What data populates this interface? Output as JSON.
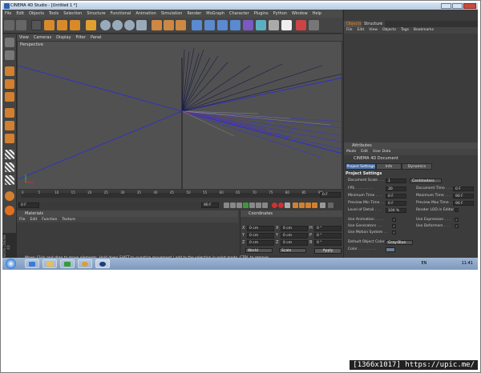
{
  "window": {
    "title": "CINEMA 4D Studio - [Untitled 1 *]"
  },
  "menubar": [
    "File",
    "Edit",
    "Objects",
    "Tools",
    "Selection",
    "Structure",
    "Functional",
    "Animation",
    "Simulation",
    "Render",
    "MoGraph",
    "Character",
    "Plugins",
    "Python",
    "Window",
    "Help"
  ],
  "viewport": {
    "menu": [
      "View",
      "Cameras",
      "Display",
      "Filter",
      "Panel"
    ],
    "label": "Perspective"
  },
  "timeline": {
    "ticks": [
      "0",
      "5",
      "10",
      "15",
      "20",
      "25",
      "30",
      "35",
      "40",
      "45",
      "50",
      "55",
      "60",
      "65",
      "70",
      "75",
      "80",
      "85",
      "90"
    ],
    "end_field": "0 F",
    "start_field": "0 F",
    "current_field": "90 F"
  },
  "materials": {
    "title": "Materials",
    "menu": [
      "File",
      "Edit",
      "Function",
      "Texture"
    ]
  },
  "coordinates": {
    "title": "Coordinates",
    "rows": [
      {
        "a": "X",
        "a_val": "0 cm",
        "b": "X",
        "b_val": "0 cm",
        "c": "H",
        "c_val": "0 °"
      },
      {
        "a": "Y",
        "a_val": "0 cm",
        "b": "Y",
        "b_val": "0 cm",
        "c": "P",
        "c_val": "0 °"
      },
      {
        "a": "Z",
        "a_val": "0 cm",
        "b": "Z",
        "b_val": "0 cm",
        "c": "B",
        "c_val": "0 °"
      }
    ],
    "mode_world": "World",
    "mode_scale": "Scale",
    "apply": "Apply"
  },
  "status": "Move: Click and drag to move elements. Hold down SHIFT to quantize movement / add to the selection in point mode, CTRL to remove.",
  "side_brand": "MAXON CINEMA 4D",
  "objects_panel": {
    "tabs": [
      "Objects",
      "Structure"
    ],
    "menu": [
      "File",
      "Edit",
      "View",
      "Objects",
      "Tags",
      "Bookmarks"
    ]
  },
  "attributes": {
    "title": "Attributes",
    "menu": [
      "Mode",
      "Edit",
      "User Data"
    ],
    "doc_label": "CINEMA 4D Document",
    "tabs": [
      "Project Settings",
      "Info",
      "Dynamics"
    ],
    "section": "Project Settings",
    "doc_scale_label": "Document Scale . . . .",
    "doc_scale_val": "1",
    "doc_scale_unit": "Centimeters",
    "left_props": [
      {
        "label": "FPS . . . . . . . .",
        "value": "30"
      },
      {
        "label": "Minimum Time . . .",
        "value": "0 F"
      },
      {
        "label": "Preview Min Time . .",
        "value": "0 F"
      },
      {
        "label": "Level of Detail . . .",
        "value": "100 %"
      }
    ],
    "right_props": [
      {
        "label": "Document Time . . .",
        "value": "0 F"
      },
      {
        "label": "Maximum Time . . .",
        "value": "90 F"
      },
      {
        "label": "Preview Max Time . .",
        "value": "90 F"
      },
      {
        "label": "Render LOD in Editor",
        "value": ""
      }
    ],
    "left_checks": [
      "Use Animation . . . .",
      "Use Generators . . .",
      "Use Motion System . ."
    ],
    "right_checks": [
      "Use Expression . . .",
      "Use Deformers . . ."
    ],
    "color_label": "Default Object Color",
    "color_value": "Gray-Blue",
    "color_row": "Color . . . . . . . ."
  },
  "taskbar": {
    "lang": "EN",
    "time": "11:41"
  },
  "footer_text": "[1366x1017] https://upic.me/"
}
